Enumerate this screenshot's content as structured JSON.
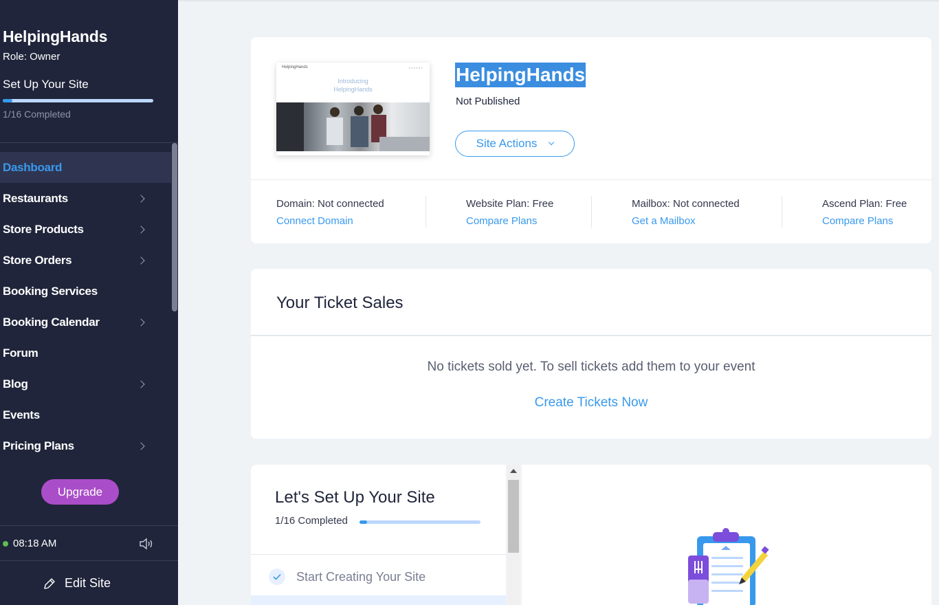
{
  "sidebar": {
    "site_name": "HelpingHands",
    "role": "Role: Owner",
    "setup_title": "Set Up Your Site",
    "progress": 0.0625,
    "completed": "1/16 Completed",
    "nav": [
      {
        "label": "Dashboard",
        "active": true,
        "has_children": false
      },
      {
        "label": "Restaurants",
        "has_children": true
      },
      {
        "label": "Store Products",
        "has_children": true
      },
      {
        "label": "Store Orders",
        "has_children": true
      },
      {
        "label": "Booking Services",
        "has_children": false
      },
      {
        "label": "Booking Calendar",
        "has_children": true
      },
      {
        "label": "Forum",
        "has_children": false
      },
      {
        "label": "Blog",
        "has_children": true
      },
      {
        "label": "Events",
        "has_children": false
      },
      {
        "label": "Pricing Plans",
        "has_children": true
      }
    ],
    "upgrade_label": "Upgrade",
    "time": "08:18 AM",
    "edit_site_label": "Edit Site"
  },
  "site_card": {
    "thumbnail": {
      "brand": "HelpingHands",
      "line1": "Introducing",
      "line2": "HelpingHands"
    },
    "title": "HelpingHands",
    "status": "Not Published",
    "actions_label": "Site Actions",
    "plans": [
      {
        "label": "Domain: Not connected",
        "link": "Connect Domain"
      },
      {
        "label": "Website Plan: Free",
        "link": "Compare Plans"
      },
      {
        "label": "Mailbox: Not connected",
        "link": "Get a Mailbox"
      },
      {
        "label": "Ascend Plan: Free",
        "link": "Compare Plans"
      }
    ]
  },
  "tickets": {
    "title": "Your Ticket Sales",
    "message": "No tickets sold yet. To sell tickets add them to your event",
    "cta": "Create Tickets Now"
  },
  "setup": {
    "title": "Let's Set Up Your Site",
    "completed": "1/16 Completed",
    "progress": 0.0625,
    "steps": [
      {
        "label": "Start Creating Your Site",
        "done": true
      }
    ]
  },
  "colors": {
    "sidebar_bg": "#20253b",
    "accent": "#3899ec",
    "upgrade": "#aa4dc8",
    "page_bg": "#f0f3f6"
  }
}
